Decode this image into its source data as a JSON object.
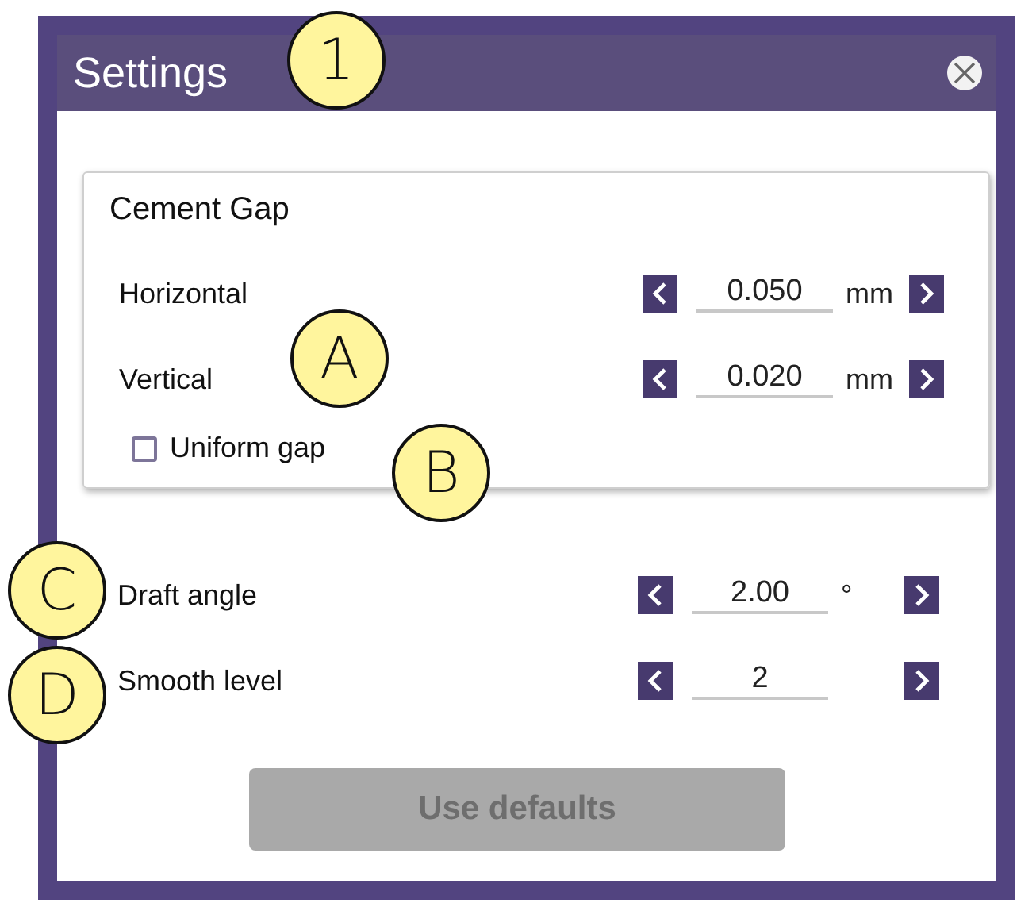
{
  "window": {
    "title": "Settings"
  },
  "group": {
    "title": "Cement Gap",
    "rows": [
      {
        "label": "Horizontal",
        "value": "0.050",
        "unit": "mm"
      },
      {
        "label": "Vertical",
        "value": "0.020",
        "unit": "mm"
      }
    ],
    "checkbox": {
      "label": "Uniform gap",
      "checked": false
    }
  },
  "rows": [
    {
      "label": "Draft angle",
      "value": "2.00",
      "unit": "°"
    },
    {
      "label": "Smooth level",
      "value": "2"
    }
  ],
  "button": {
    "label": "Use defaults",
    "disabled": true
  },
  "callouts": [
    {
      "label": "1"
    },
    {
      "label": "A"
    },
    {
      "label": "B"
    },
    {
      "label": "C"
    },
    {
      "label": "D"
    }
  ]
}
